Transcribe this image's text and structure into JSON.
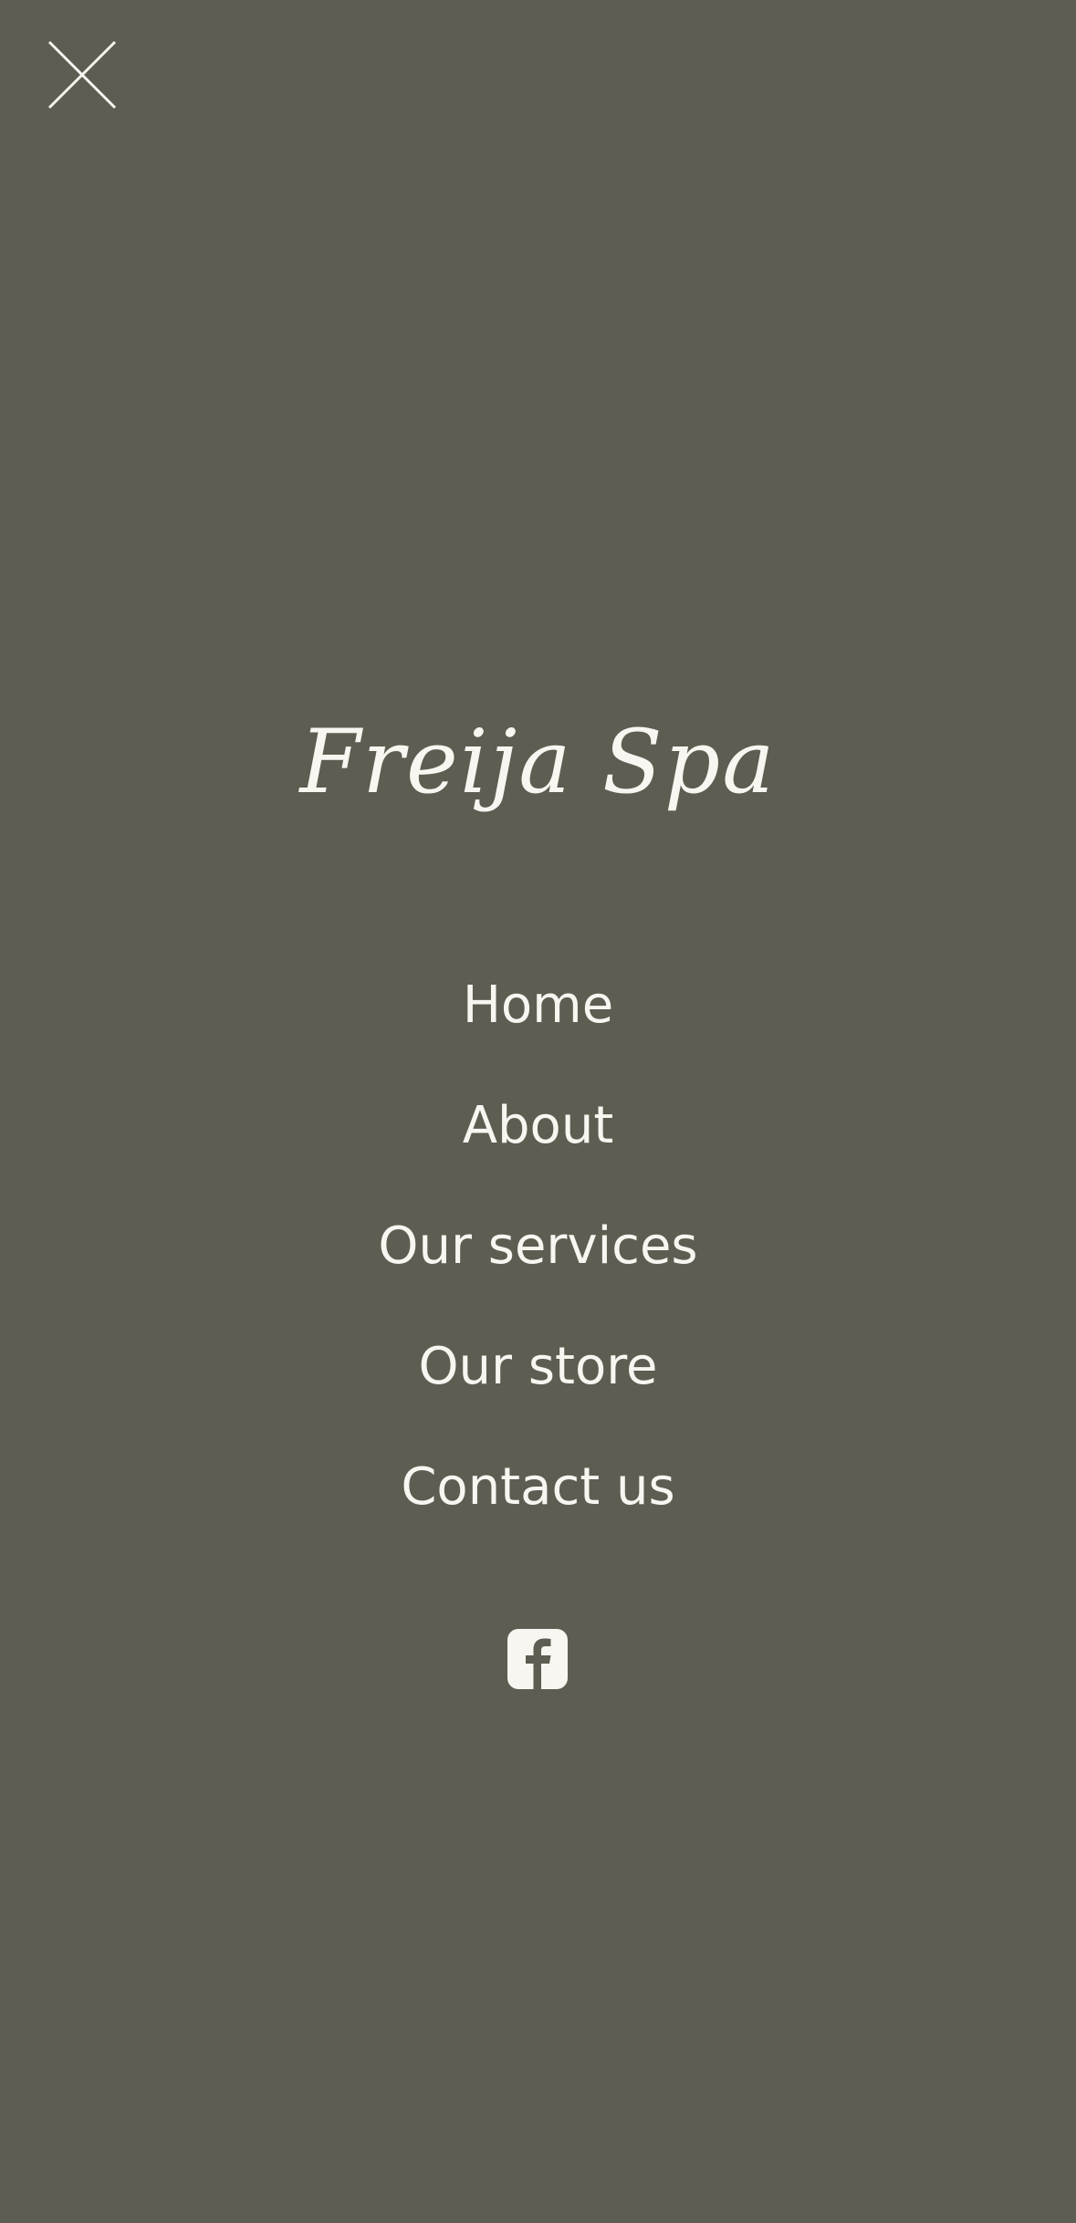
{
  "menu": {
    "close_icon": "close-icon",
    "brand": "Freija Spa",
    "items": [
      {
        "label": "Home"
      },
      {
        "label": "About"
      },
      {
        "label": "Our services"
      },
      {
        "label": "Our store"
      },
      {
        "label": "Contact us"
      }
    ],
    "social_icon": "facebook-icon"
  },
  "colors": {
    "background": "#5d5d51",
    "foreground": "#f7f6f1"
  }
}
